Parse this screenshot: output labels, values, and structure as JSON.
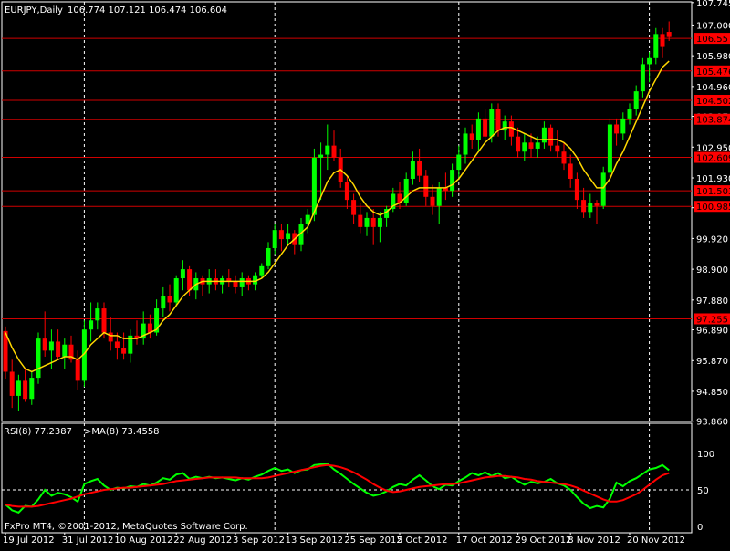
{
  "header": {
    "symbol_label": "EURJPY,Daily",
    "ohlc_label": "106.774 107.121 106.474 106.604"
  },
  "footer": {
    "copyright": "FxPro MT4, ©2001-2012, MetaQuotes Software Corp."
  },
  "colors": {
    "background": "#000000",
    "grid": "#ffffff",
    "up_candle": "#00ff00",
    "down_candle": "#ff0000",
    "ma_line": "#ffd700",
    "level_line": "#d00000",
    "level_label_bg": "#ff0000",
    "rsi_line": "#00ff00",
    "rsi_ma_line": "#ff0000",
    "text": "#ffffff"
  },
  "chart_data": [
    {
      "type": "candlestick",
      "symbol": "EURJPY",
      "timeframe": "Daily",
      "ylim": [
        93.85,
        107.77
      ],
      "ytick_labels": [
        "107.000",
        "105.980",
        "104.960",
        "103.970",
        "102.950",
        "101.930",
        "100.940",
        "99.920",
        "98.900",
        "97.880",
        "96.890",
        "95.870",
        "94.850",
        "93.860"
      ],
      "ytick_values": [
        107.0,
        105.98,
        104.96,
        103.97,
        102.95,
        101.93,
        100.94,
        99.92,
        98.9,
        97.88,
        96.89,
        95.87,
        94.85,
        93.86
      ],
      "top_tick_label": "107.745",
      "top_tick_value": 107.745,
      "horizontal_levels": [
        {
          "label": "106.557",
          "value": 106.557
        },
        {
          "label": "105.476",
          "value": 105.476
        },
        {
          "label": "104.502",
          "value": 104.502
        },
        {
          "label": "103.874",
          "value": 103.874
        },
        {
          "label": "102.609",
          "value": 102.609
        },
        {
          "label": "101.503",
          "value": 101.503
        },
        {
          "label": "100.985",
          "value": 100.985
        },
        {
          "label": "97.255",
          "value": 97.255
        }
      ],
      "x_labels": [
        "19 Jul 2012",
        "31 Jul 2012",
        "10 Aug 2012",
        "22 Aug 2012",
        "3 Sep 2012",
        "13 Sep 2012",
        "25 Sep 2012",
        "5 Oct 2012",
        "17 Oct 2012",
        "29 Oct 2012",
        "8 Nov 2012",
        "20 Nov 2012"
      ],
      "x_label_bar_index": [
        0,
        9,
        17,
        26,
        35,
        43,
        52,
        60,
        69,
        78,
        86,
        95
      ],
      "bar_count": 102,
      "vertical_grid_bar_index": [
        12,
        41,
        69,
        98
      ],
      "legend": "none",
      "candles": [
        {
          "o": 96.85,
          "h": 97.0,
          "l": 95.25,
          "c": 95.5
        },
        {
          "o": 95.5,
          "h": 95.9,
          "l": 94.3,
          "c": 94.7
        },
        {
          "o": 94.7,
          "h": 95.4,
          "l": 94.2,
          "c": 95.2
        },
        {
          "o": 95.2,
          "h": 95.6,
          "l": 94.5,
          "c": 94.6
        },
        {
          "o": 94.6,
          "h": 95.5,
          "l": 94.4,
          "c": 95.3
        },
        {
          "o": 95.3,
          "h": 96.8,
          "l": 95.1,
          "c": 96.6
        },
        {
          "o": 96.6,
          "h": 97.5,
          "l": 96.0,
          "c": 96.2
        },
        {
          "o": 96.2,
          "h": 96.9,
          "l": 95.6,
          "c": 96.5
        },
        {
          "o": 96.5,
          "h": 96.9,
          "l": 95.9,
          "c": 96.0
        },
        {
          "o": 96.0,
          "h": 96.6,
          "l": 95.6,
          "c": 96.4
        },
        {
          "o": 96.4,
          "h": 96.7,
          "l": 95.8,
          "c": 95.9
        },
        {
          "o": 95.9,
          "h": 96.2,
          "l": 94.9,
          "c": 95.2
        },
        {
          "o": 95.2,
          "h": 97.2,
          "l": 95.0,
          "c": 96.9
        },
        {
          "o": 96.9,
          "h": 97.8,
          "l": 96.5,
          "c": 97.2
        },
        {
          "o": 97.2,
          "h": 97.8,
          "l": 96.9,
          "c": 97.6
        },
        {
          "o": 97.6,
          "h": 97.8,
          "l": 96.6,
          "c": 96.8
        },
        {
          "o": 96.8,
          "h": 97.3,
          "l": 96.2,
          "c": 96.5
        },
        {
          "o": 96.5,
          "h": 96.8,
          "l": 95.9,
          "c": 96.3
        },
        {
          "o": 96.3,
          "h": 96.8,
          "l": 95.9,
          "c": 96.1
        },
        {
          "o": 96.1,
          "h": 96.9,
          "l": 95.8,
          "c": 96.7
        },
        {
          "o": 96.7,
          "h": 97.2,
          "l": 96.4,
          "c": 96.6
        },
        {
          "o": 96.6,
          "h": 97.5,
          "l": 96.4,
          "c": 97.1
        },
        {
          "o": 97.1,
          "h": 97.4,
          "l": 96.6,
          "c": 96.8
        },
        {
          "o": 96.8,
          "h": 97.9,
          "l": 96.7,
          "c": 97.6
        },
        {
          "o": 97.6,
          "h": 98.3,
          "l": 97.3,
          "c": 98.0
        },
        {
          "o": 98.0,
          "h": 98.4,
          "l": 97.5,
          "c": 97.8
        },
        {
          "o": 97.8,
          "h": 98.7,
          "l": 97.7,
          "c": 98.6
        },
        {
          "o": 98.6,
          "h": 99.2,
          "l": 98.2,
          "c": 98.9
        },
        {
          "o": 98.9,
          "h": 99.0,
          "l": 98.0,
          "c": 98.2
        },
        {
          "o": 98.2,
          "h": 98.8,
          "l": 97.9,
          "c": 98.6
        },
        {
          "o": 98.6,
          "h": 98.7,
          "l": 98.0,
          "c": 98.4
        },
        {
          "o": 98.4,
          "h": 98.9,
          "l": 98.1,
          "c": 98.6
        },
        {
          "o": 98.6,
          "h": 98.9,
          "l": 98.2,
          "c": 98.4
        },
        {
          "o": 98.4,
          "h": 98.7,
          "l": 98.1,
          "c": 98.6
        },
        {
          "o": 98.6,
          "h": 98.9,
          "l": 98.3,
          "c": 98.5
        },
        {
          "o": 98.5,
          "h": 98.7,
          "l": 98.1,
          "c": 98.3
        },
        {
          "o": 98.3,
          "h": 98.8,
          "l": 98.0,
          "c": 98.6
        },
        {
          "o": 98.6,
          "h": 98.7,
          "l": 98.2,
          "c": 98.4
        },
        {
          "o": 98.4,
          "h": 98.8,
          "l": 98.2,
          "c": 98.7
        },
        {
          "o": 98.7,
          "h": 99.1,
          "l": 98.6,
          "c": 99.0
        },
        {
          "o": 99.0,
          "h": 99.8,
          "l": 98.9,
          "c": 99.6
        },
        {
          "o": 99.6,
          "h": 100.4,
          "l": 99.4,
          "c": 100.2
        },
        {
          "o": 100.2,
          "h": 100.4,
          "l": 99.5,
          "c": 99.9
        },
        {
          "o": 99.9,
          "h": 100.4,
          "l": 99.7,
          "c": 100.1
        },
        {
          "o": 100.1,
          "h": 100.2,
          "l": 99.4,
          "c": 99.7
        },
        {
          "o": 99.7,
          "h": 100.6,
          "l": 99.5,
          "c": 100.4
        },
        {
          "o": 100.4,
          "h": 100.9,
          "l": 100.1,
          "c": 100.7
        },
        {
          "o": 100.7,
          "h": 102.9,
          "l": 100.5,
          "c": 102.6
        },
        {
          "o": 102.6,
          "h": 103.1,
          "l": 101.2,
          "c": 102.7
        },
        {
          "o": 102.7,
          "h": 103.7,
          "l": 102.2,
          "c": 103.0
        },
        {
          "o": 103.0,
          "h": 103.5,
          "l": 102.5,
          "c": 102.6
        },
        {
          "o": 102.6,
          "h": 102.9,
          "l": 101.6,
          "c": 101.8
        },
        {
          "o": 101.8,
          "h": 102.0,
          "l": 100.9,
          "c": 101.2
        },
        {
          "o": 101.2,
          "h": 101.4,
          "l": 100.4,
          "c": 100.7
        },
        {
          "o": 100.7,
          "h": 101.1,
          "l": 100.1,
          "c": 100.3
        },
        {
          "o": 100.3,
          "h": 100.8,
          "l": 100.0,
          "c": 100.6
        },
        {
          "o": 100.6,
          "h": 100.9,
          "l": 99.7,
          "c": 100.3
        },
        {
          "o": 100.3,
          "h": 100.8,
          "l": 99.8,
          "c": 100.6
        },
        {
          "o": 100.6,
          "h": 101.0,
          "l": 100.3,
          "c": 100.9
        },
        {
          "o": 100.9,
          "h": 101.6,
          "l": 100.8,
          "c": 101.4
        },
        {
          "o": 101.4,
          "h": 101.8,
          "l": 100.9,
          "c": 101.1
        },
        {
          "o": 101.1,
          "h": 102.1,
          "l": 101.0,
          "c": 101.9
        },
        {
          "o": 101.9,
          "h": 102.8,
          "l": 101.7,
          "c": 102.5
        },
        {
          "o": 102.5,
          "h": 102.9,
          "l": 101.8,
          "c": 102.0
        },
        {
          "o": 102.0,
          "h": 102.2,
          "l": 101.0,
          "c": 101.3
        },
        {
          "o": 101.3,
          "h": 101.7,
          "l": 100.7,
          "c": 101.0
        },
        {
          "o": 101.0,
          "h": 101.8,
          "l": 100.4,
          "c": 101.6
        },
        {
          "o": 101.6,
          "h": 102.1,
          "l": 101.2,
          "c": 101.5
        },
        {
          "o": 101.5,
          "h": 102.4,
          "l": 101.3,
          "c": 102.2
        },
        {
          "o": 102.2,
          "h": 103.0,
          "l": 101.9,
          "c": 102.7
        },
        {
          "o": 102.7,
          "h": 103.6,
          "l": 102.4,
          "c": 103.4
        },
        {
          "o": 103.4,
          "h": 103.7,
          "l": 102.9,
          "c": 103.2
        },
        {
          "o": 103.2,
          "h": 104.1,
          "l": 102.8,
          "c": 103.9
        },
        {
          "o": 103.9,
          "h": 104.2,
          "l": 103.0,
          "c": 103.3
        },
        {
          "o": 103.3,
          "h": 104.4,
          "l": 103.1,
          "c": 104.2
        },
        {
          "o": 104.2,
          "h": 104.4,
          "l": 103.3,
          "c": 103.5
        },
        {
          "o": 103.5,
          "h": 104.0,
          "l": 103.2,
          "c": 103.8
        },
        {
          "o": 103.8,
          "h": 104.0,
          "l": 103.0,
          "c": 103.3
        },
        {
          "o": 103.3,
          "h": 103.6,
          "l": 102.6,
          "c": 102.8
        },
        {
          "o": 102.8,
          "h": 103.4,
          "l": 102.5,
          "c": 103.1
        },
        {
          "o": 103.1,
          "h": 103.4,
          "l": 102.6,
          "c": 102.9
        },
        {
          "o": 102.9,
          "h": 103.3,
          "l": 102.6,
          "c": 103.1
        },
        {
          "o": 103.1,
          "h": 103.8,
          "l": 102.9,
          "c": 103.6
        },
        {
          "o": 103.6,
          "h": 103.7,
          "l": 102.8,
          "c": 103.0
        },
        {
          "o": 103.0,
          "h": 103.5,
          "l": 102.6,
          "c": 102.8
        },
        {
          "o": 102.8,
          "h": 103.1,
          "l": 102.2,
          "c": 102.4
        },
        {
          "o": 102.4,
          "h": 102.7,
          "l": 101.6,
          "c": 101.9
        },
        {
          "o": 101.9,
          "h": 102.1,
          "l": 100.9,
          "c": 101.2
        },
        {
          "o": 101.2,
          "h": 101.6,
          "l": 100.6,
          "c": 100.8
        },
        {
          "o": 100.8,
          "h": 101.4,
          "l": 100.6,
          "c": 101.1
        },
        {
          "o": 101.1,
          "h": 101.2,
          "l": 100.4,
          "c": 101.0
        },
        {
          "o": 101.0,
          "h": 102.3,
          "l": 100.9,
          "c": 102.1
        },
        {
          "o": 102.1,
          "h": 103.9,
          "l": 101.8,
          "c": 103.7
        },
        {
          "o": 103.7,
          "h": 103.9,
          "l": 103.0,
          "c": 103.4
        },
        {
          "o": 103.4,
          "h": 104.1,
          "l": 103.2,
          "c": 103.9
        },
        {
          "o": 103.9,
          "h": 104.4,
          "l": 103.7,
          "c": 104.2
        },
        {
          "o": 104.2,
          "h": 105.0,
          "l": 104.0,
          "c": 104.8
        },
        {
          "o": 104.8,
          "h": 105.9,
          "l": 104.6,
          "c": 105.7
        },
        {
          "o": 105.7,
          "h": 106.1,
          "l": 105.1,
          "c": 105.9
        },
        {
          "o": 105.9,
          "h": 106.9,
          "l": 105.7,
          "c": 106.7
        },
        {
          "o": 106.7,
          "h": 106.9,
          "l": 105.9,
          "c": 106.3
        },
        {
          "o": 106.77,
          "h": 107.12,
          "l": 106.47,
          "c": 106.6
        }
      ],
      "ma_line": [
        96.8,
        96.3,
        95.9,
        95.6,
        95.5,
        95.6,
        95.7,
        95.8,
        95.9,
        96.0,
        96.0,
        95.9,
        96.1,
        96.4,
        96.6,
        96.8,
        96.7,
        96.7,
        96.6,
        96.6,
        96.6,
        96.7,
        96.8,
        96.9,
        97.2,
        97.4,
        97.7,
        98.0,
        98.2,
        98.4,
        98.5,
        98.5,
        98.5,
        98.5,
        98.5,
        98.5,
        98.5,
        98.5,
        98.5,
        98.6,
        98.8,
        99.1,
        99.4,
        99.7,
        99.9,
        100.1,
        100.3,
        100.8,
        101.3,
        101.8,
        102.1,
        102.2,
        102.0,
        101.7,
        101.3,
        101.0,
        100.8,
        100.7,
        100.8,
        101.0,
        101.1,
        101.3,
        101.5,
        101.6,
        101.6,
        101.6,
        101.6,
        101.6,
        101.7,
        101.9,
        102.2,
        102.5,
        102.8,
        103.1,
        103.3,
        103.5,
        103.6,
        103.6,
        103.5,
        103.4,
        103.3,
        103.2,
        103.2,
        103.2,
        103.2,
        103.1,
        102.9,
        102.6,
        102.2,
        101.9,
        101.6,
        101.6,
        101.9,
        102.4,
        102.8,
        103.3,
        103.8,
        104.3,
        104.8,
        105.2,
        105.6,
        105.8
      ]
    },
    {
      "type": "line",
      "indicator_label": "RSI(8) 77.2387",
      "ma_label": ">MA(8) 73.4558",
      "ylim": [
        0,
        100
      ],
      "ytick_labels": [
        "100",
        "50",
        "0"
      ],
      "ytick_values": [
        100,
        50,
        0
      ],
      "dashed_level": 50,
      "legend": "top-left",
      "series": [
        {
          "name": "RSI(8)",
          "values": [
            30,
            22,
            19,
            28,
            27,
            37,
            50,
            42,
            46,
            44,
            40,
            34,
            58,
            62,
            65,
            56,
            50,
            53,
            52,
            55,
            54,
            58,
            56,
            60,
            66,
            64,
            71,
            73,
            65,
            68,
            66,
            68,
            66,
            67,
            65,
            63,
            66,
            64,
            68,
            71,
            76,
            80,
            76,
            78,
            73,
            77,
            78,
            84,
            85,
            86,
            78,
            72,
            65,
            58,
            52,
            46,
            42,
            44,
            48,
            54,
            58,
            56,
            64,
            70,
            63,
            55,
            51,
            57,
            56,
            62,
            67,
            73,
            70,
            74,
            69,
            73,
            66,
            68,
            62,
            57,
            61,
            59,
            61,
            65,
            59,
            56,
            50,
            40,
            31,
            25,
            28,
            26,
            38,
            60,
            55,
            62,
            66,
            72,
            78,
            80,
            84,
            77
          ]
        },
        {
          "name": "MA(8)",
          "values": [
            30,
            28,
            27,
            27,
            27,
            28,
            30,
            32,
            34,
            36,
            38,
            41,
            44,
            46,
            48,
            50,
            51,
            52,
            53,
            53,
            54,
            55,
            56,
            57,
            58,
            60,
            62,
            63,
            64,
            65,
            66,
            67,
            67,
            67,
            67,
            67,
            66,
            66,
            66,
            66,
            67,
            69,
            71,
            73,
            75,
            77,
            79,
            81,
            83,
            84,
            83,
            81,
            78,
            74,
            69,
            64,
            58,
            53,
            49,
            47,
            48,
            50,
            52,
            54,
            55,
            56,
            57,
            58,
            58,
            59,
            61,
            63,
            65,
            67,
            68,
            69,
            69,
            68,
            67,
            65,
            64,
            62,
            61,
            60,
            59,
            58,
            56,
            53,
            49,
            45,
            41,
            37,
            34,
            34,
            36,
            40,
            44,
            50,
            57,
            64,
            70,
            73
          ]
        }
      ]
    }
  ]
}
